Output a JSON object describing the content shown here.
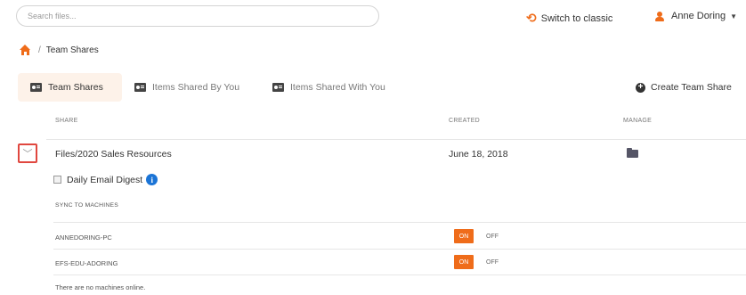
{
  "search": {
    "placeholder": "Search files..."
  },
  "header": {
    "switch_label": "Switch to classic",
    "user_name": "Anne Doring"
  },
  "breadcrumb": {
    "separator": "/",
    "current": "Team Shares"
  },
  "tabs": [
    {
      "label": "Team Shares",
      "active": true
    },
    {
      "label": "Items Shared By You",
      "active": false
    },
    {
      "label": "Items Shared With You",
      "active": false
    }
  ],
  "create_label": "Create Team Share",
  "table": {
    "columns": [
      "SHARE",
      "CREATED",
      "MANAGE"
    ],
    "row": {
      "share": "Files/2020 Sales Resources",
      "created": "June 18, 2018"
    }
  },
  "digest_label": "Daily Email Digest",
  "sync": {
    "heading": "SYNC TO MACHINES",
    "machines": [
      {
        "name": "ANNEDORING-PC",
        "on_label": "ON",
        "off_label": "OFF",
        "state": "on"
      },
      {
        "name": "EFS-EDU-ADORING",
        "on_label": "ON",
        "off_label": "OFF",
        "state": "on"
      }
    ],
    "empty_message": "There are no machines online."
  },
  "colors": {
    "accent": "#ef6c1a",
    "highlight_border": "#e0473f",
    "info": "#1b74d6",
    "active_tab_bg": "#fdf2e9"
  }
}
